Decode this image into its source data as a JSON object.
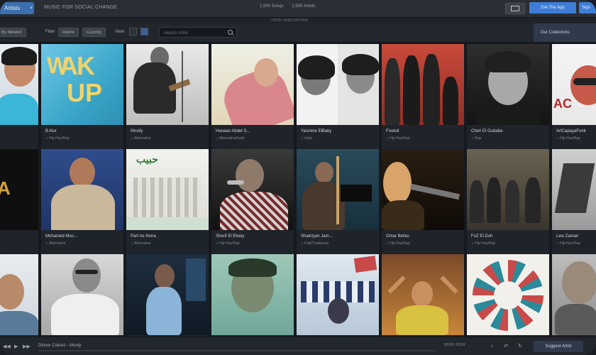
{
  "app": {
    "brand_label": "Artists",
    "title": "MUSIC FOR SOCIAL CHANGE",
    "stats": [
      "1,500 Songs",
      "2,600 Artists"
    ],
    "subtitle": "YOUR LINKS GATHER",
    "primary_action": "Get The App",
    "secondary_action": "Sign"
  },
  "filters": {
    "sort_label": "By Newest",
    "filter_label": "Filter",
    "genre_label": "Genre",
    "country_label": "Country",
    "view_label": "View",
    "search_placeholder": "Search Artist",
    "collections_label": "Our Collections"
  },
  "artists": [
    {
      "name": "",
      "genre": ""
    },
    {
      "name": "B-Nur",
      "genre": "Hip Hop/Rap"
    },
    {
      "name": "Mostly",
      "genre": "Alternative"
    },
    {
      "name": "Hanaan Abdel S...",
      "genre": "Alternative/Indie"
    },
    {
      "name": "Yasmine ElBaky",
      "genre": "Indie"
    },
    {
      "name": "Fredoll",
      "genre": "Hip Hop/Rap"
    },
    {
      "name": "Cheri El Gudaba",
      "genre": "Rap"
    },
    {
      "name": "ArtCapayaFunk",
      "genre": "Hip Hop/Rap"
    },
    {
      "name": "",
      "genre": ""
    },
    {
      "name": "Mohamed Mou...",
      "genre": "Alternative"
    },
    {
      "name": "Part Ae Nona",
      "genre": "Alternative"
    },
    {
      "name": "Sherif El Elway",
      "genre": "Hip Hop/Rap"
    },
    {
      "name": "Shakriyan Jam...",
      "genre": "Folk/Traditional"
    },
    {
      "name": "Omar Bellas",
      "genre": "Hip Hop/Rap"
    },
    {
      "name": "FoZ El Doh",
      "genre": "Hip Hop/Rap"
    },
    {
      "name": "Lew Zaman",
      "genre": "Hip Hop/Rap"
    },
    {
      "name": "",
      "genre": ""
    },
    {
      "name": "",
      "genre": ""
    },
    {
      "name": "",
      "genre": ""
    },
    {
      "name": "",
      "genre": ""
    },
    {
      "name": "",
      "genre": ""
    },
    {
      "name": "",
      "genre": ""
    },
    {
      "name": "",
      "genre": ""
    },
    {
      "name": "",
      "genre": ""
    }
  ],
  "player": {
    "prev_icon": "previous-icon",
    "play_icon": "play-icon",
    "next_icon": "next-icon",
    "track": "Dinner Cobrez - Mooty",
    "time": "00:00 / 03:24",
    "progress": 0,
    "suggest_label": "Suggest Artist"
  },
  "colors": {
    "accent": "#3d7dd6",
    "background": "#16191e",
    "panel": "#22262d"
  }
}
